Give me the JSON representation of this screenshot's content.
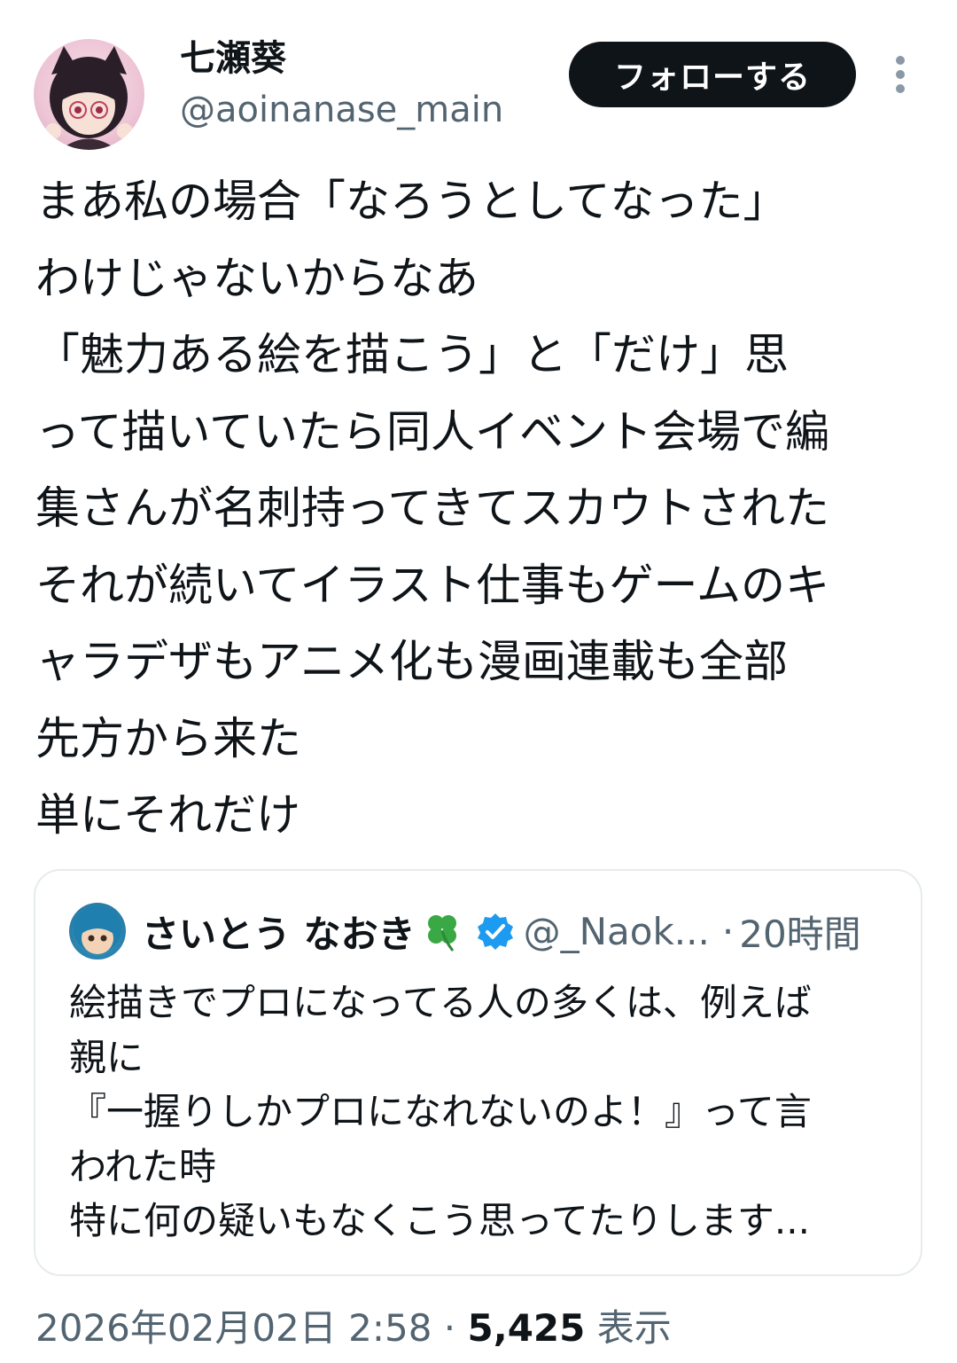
{
  "author": {
    "name": "七瀬葵",
    "handle": "@aoinanase_main",
    "follow_label": "フォローする"
  },
  "tweet": {
    "lines": [
      "まあ私の場合「なろうとしてなった」",
      "わけじゃないからなあ",
      "「魅力ある絵を描こう」と「だけ」思",
      "って描いていたら同人イベント会場で編",
      "集さんが名刺持ってきてスカウトされた",
      "それが続いてイラスト仕事もゲームのキ",
      "ャラデザもアニメ化も漫画連載も全部",
      "先方から来た",
      "単にそれだけ"
    ]
  },
  "quoted": {
    "name": "さいとう なおき",
    "handle": "@_Naok...",
    "separator": "·",
    "time": "20時間",
    "lines": [
      "絵描きでプロになってる人の多くは、例えば",
      "親に",
      "『一握りしかプロになれないのよ！』って言",
      "われた時",
      "特に何の疑いもなくこう思ってたりします..."
    ]
  },
  "meta": {
    "date": "2026年02月02日 2:58",
    "separator": " · ",
    "views_count": "5,425",
    "views_label": " 表示"
  },
  "colors": {
    "text": "#0f1419",
    "secondary": "#536471",
    "verified": "#1d9bf0",
    "button_bg": "#0f1419"
  }
}
